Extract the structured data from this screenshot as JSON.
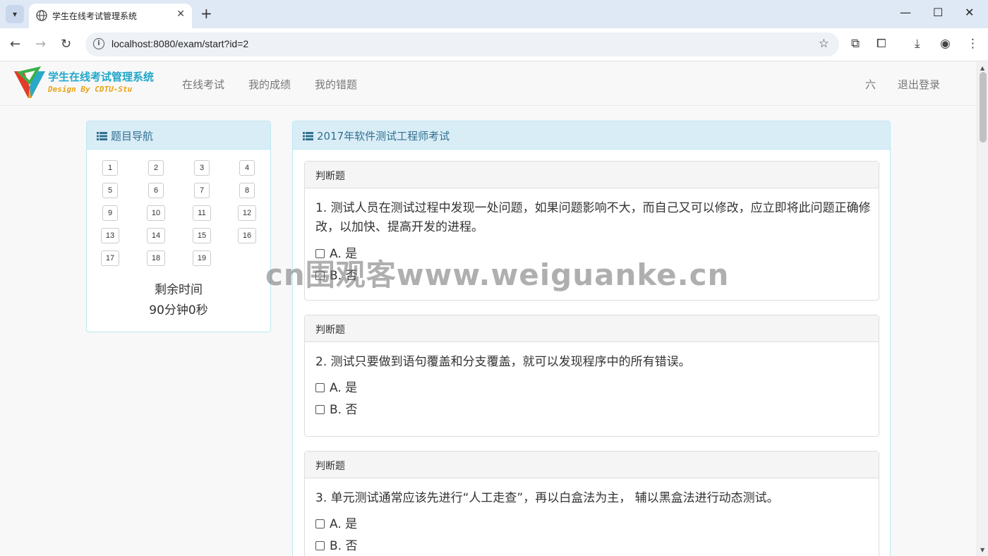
{
  "browser": {
    "tab_title": "学生在线考试管理系统",
    "url": "localhost:8080/exam/start?id=2"
  },
  "app": {
    "logo_title": "学生在线考试管理系统",
    "logo_subtitle": "Design By CDTU-Stu",
    "nav": [
      "在线考试",
      "我的成绩",
      "我的错题"
    ],
    "user_name": "六",
    "logout": "退出登录"
  },
  "sidebar": {
    "heading": "题目导航",
    "questions": [
      "1",
      "2",
      "3",
      "4",
      "5",
      "6",
      "7",
      "8",
      "9",
      "10",
      "11",
      "12",
      "13",
      "14",
      "15",
      "16",
      "17",
      "18",
      "19"
    ],
    "remain_label": "剩余时间",
    "remain_time": "90分钟0秒"
  },
  "exam": {
    "title": "2017年软件测试工程师考试",
    "questions": [
      {
        "type": "判断题",
        "text": "1. 测试人员在测试过程中发现一处问题，如果问题影响不大，而自己又可以修改，应立即将此问题正确修改，以加快、提高开发的进程。",
        "options": [
          "A. 是",
          "B. 否"
        ]
      },
      {
        "type": "判断题",
        "text": "2. 测试只要做到语句覆盖和分支覆盖，就可以发现程序中的所有错误。",
        "options": [
          "A. 是",
          "B. 否"
        ]
      },
      {
        "type": "判断题",
        "text": "3. 单元测试通常应该先进行“人工走查”，再以白盒法为主， 辅以黑盒法进行动态测试。",
        "options": [
          "A. 是",
          "B. 否"
        ]
      }
    ]
  },
  "watermark": "cn围观客www.weiguanke.cn",
  "icons": {
    "tab_menu": "chevron-down-icon",
    "back": "arrow-left-icon",
    "forward": "arrow-right-icon",
    "reload": "reload-icon",
    "bookmark": "star-icon",
    "download": "download-icon",
    "profile": "account-icon",
    "menu": "more-vert-icon",
    "list": "list-icon"
  }
}
